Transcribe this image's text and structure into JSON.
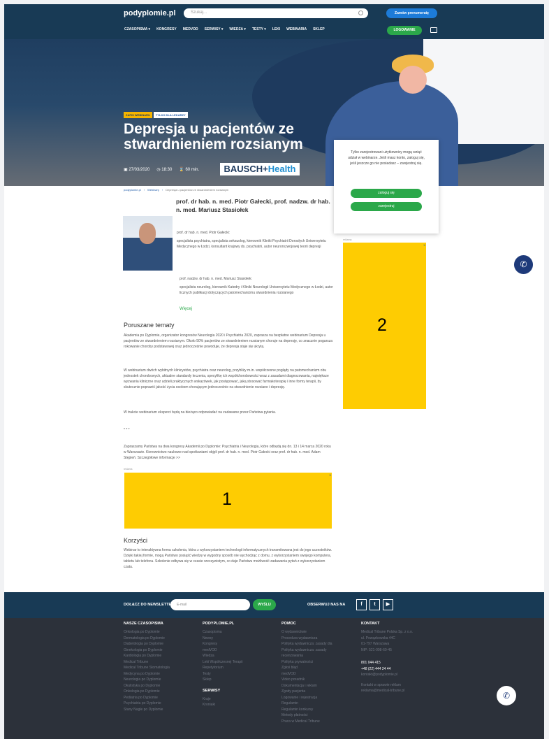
{
  "header": {
    "logo": "podyplomie.pl",
    "search_placeholder": "Szukaj...",
    "subscribe_label": "Zamów prenumeratę",
    "nav": [
      "CZASOPISMA ▾",
      "KONGRESY",
      "MEDVOD",
      "SERWISY ▾",
      "WIEDZA ▾",
      "TESTY ▾",
      "LEKI",
      "WEBINARIA",
      "SKLEP"
    ],
    "login_label": "LOGOWANIE"
  },
  "hero": {
    "tags": [
      "ZAPIS WEBINARU",
      "TYLKO DLA LEKARZY"
    ],
    "title": "Depresja u pacjentów ze stwardnieniem rozsianym",
    "date": "27/03/2020",
    "time": "18:30",
    "duration": "60 min.",
    "sponsor_a": "BAUSCH+",
    "sponsor_b": "Health"
  },
  "popup": {
    "text": "Tylko zarejestrowani użytkownicy mogą wziąć udział w webinarze. Jeśli masz konto, zaloguj się, jeśli jeszcze go nie posiadasz – zarejestruj się.",
    "login_label": "zaloguj się",
    "register_label": "zarejestruj"
  },
  "breadcrumb": [
    "podyplomie.pl",
    "Webinary",
    "Depresja u pacjentów ze stwardnieniem rozsianym"
  ],
  "authors": "prof. dr hab. n. med. Piotr Gałecki, prof. nadzw. dr hab. n. med. Mariusz Stasiołek",
  "bio1_name": "prof. dr hab. n. med. Piotr Gałecki:",
  "bio1_text": "specjalista psychiatra, specjalista seksuolog, kierownik Kliniki Psychiatrii Dorosłych Uniwersytetu Medycznego w Łodzi, konsultant krajowy ds. psychiatrii, autor neurorozwojowej teorii depresji",
  "bio2_name": "prof. nadzw. dr hab. n. med. Mariusz Stasiołek:",
  "bio2_text": "specjalista neurolog, kierownik Katedry i Kliniki Neurologii Uniwersytetu Medycznego w Łodzi, autor licznych publikacji dotyczących patomechanizmu stwardnienia rozsianego",
  "more_label": "Więcej",
  "topics_heading": "Poruszane tematy",
  "p1": "Akademia po Dyplomie, organizator kongresów Neurologia 2020 i Psychiatria 2020, zaprasza na bezpłatne webinarium Depresja u pacjentów ze stwardnieniem rozsianym. Około 50% pacjentów ze stwardnieniem rozsianym choruje na depresję, co znacznie pogarsza rokowanie choroby podstawowej oraz jednocześnie powoduje, że depresja staje się ukrytą.",
  "p2": "W webinarium dwóch wybitnych klinicystów, psychiatra oraz neurolog, przybliży m.in. współczesne poglądy na patomechanizm obu jednostek chorobowych, aktualne standardy leczenia, specyfikę ich współchorobowości wraz z zasadami diagnozowania, największe wyzwania kliniczne oraz udzieli praktycznych wskazówek, jak postępować, jaką stosować farmakoterapię i inne formy terapii, by skutecznie poprawić jakość życia osobom chorującym jednocześnie na stwardnienie rozsiane i depresję.",
  "p3": "W trakcie webinarium eksperci będą na bieżąco odpowiadać na zadawane przez Państwa pytania.",
  "dots": "* * *",
  "p4": "Zapraszamy Państwa na dwa kongresy Akademii po Dyplomie: Psychiatria i Neurologia, które odbędą się dn. 13 i 14 marca 2020 roku w Warszawie. Kierownictwo naukowe nad spotkaniami objęli prof. dr hab. n. med. Piotr Gałecki oraz prof. dr hab. n. med. Adam Stępień. Szczegółowe informacje >>",
  "ad_label": "reklama",
  "ad1_number": "1",
  "ad2_number": "2",
  "ad_close": "X",
  "benefits_heading": "Korzyści",
  "p5": "Webinar to interaktywna forma szkolenia, która z wykorzystaniem technologii informatycznych transmitowana jest do jego uczestników. Dzięki takiej formie, mogą Państwo posiąść wiedzę w wygodny sposób nie wychodząc z domu, z wykorzystaniem swojego komputera, tabletu lub telefonu. Szkolenie odbywa się w czasie rzeczywistym, co daje Państwu możliwość zadawania pytań z wykorzystaniem czatu.",
  "newsletter": {
    "label": "DOŁĄCZ DO NEWSLETTERA",
    "placeholder": "E-mail",
    "send": "WYŚLIJ",
    "follow": "OBSERWUJ NAS NA",
    "social": [
      "f",
      "t",
      "▶"
    ]
  },
  "footer": {
    "col1": {
      "heading": "NASZE CZASOPISMA",
      "links": [
        "Onkologia po Dyplomie",
        "Dermatologia po Dyplomie",
        "Diabetologia po Dyplomie",
        "Ginekologia po Dyplomie",
        "Kardiologia po Dyplomie",
        "Medical Tribune",
        "Medical Tribune Stomatologia",
        "Medycyna po Dyplomie",
        "Neurologia po Dyplomie",
        "Okulistyka po Dyplomie",
        "Onkologia po Dyplomie",
        "Pediatria po Dyplomie",
        "Psychiatria po Dyplomie",
        "Stany Nagłe po Dyplomie"
      ]
    },
    "col2": {
      "heading": "PODYPLOMIE.PL",
      "links": [
        "Czasopisma",
        "Newsy",
        "Kongresy",
        "medVOD",
        "Wiedza",
        "Leki Współczesnej Terapii",
        "Repetytorium",
        "Testy",
        "Sklep"
      ],
      "heading2": "SERWISY",
      "links2": [
        "Kraje",
        "Kroniaki"
      ]
    },
    "col3": {
      "heading": "POMOC",
      "links": [
        "O wydawnictwie",
        "Procedura wydawnicza",
        "Polityka wydawnicza: zasady dla",
        "Polityka wydawnicza: zasady",
        "recenzowania",
        "Polityka prywatności",
        "Zgłoś błąd",
        "medVOD",
        "Video poradnik",
        "Dokumentacja i reklam",
        "Zgody pacjenta",
        "Logowanie i rejestracja",
        "Regulamin",
        "Regulamin konkursy",
        "Metody płatności",
        "Praca w Medical Tribune"
      ]
    },
    "col4": {
      "heading": "KONTAKT",
      "address": [
        "Medical Tribune Polska Sp. z o.o.",
        "ul. Powązkowska 44C",
        "01-797 Warszawa",
        "NIP: 521-008-60-45"
      ],
      "phones": [
        "801 044 415",
        "+48 (22) 444 24 44"
      ],
      "email": "kontakt@podyplomie.pl",
      "ads": [
        "Kontakt w sprawie reklam",
        "reklama@medical-tribune.pl"
      ]
    }
  },
  "icons": {
    "calendar": "calendar-icon",
    "clock": "clock-icon",
    "duration": "hourglass-icon",
    "phone": "phone-icon"
  },
  "colors": {
    "navy": "#183a55",
    "green": "#2ba84a",
    "blue": "#1d7bd8",
    "ad_yellow": "#fecc02",
    "footer": "#2c313a"
  }
}
